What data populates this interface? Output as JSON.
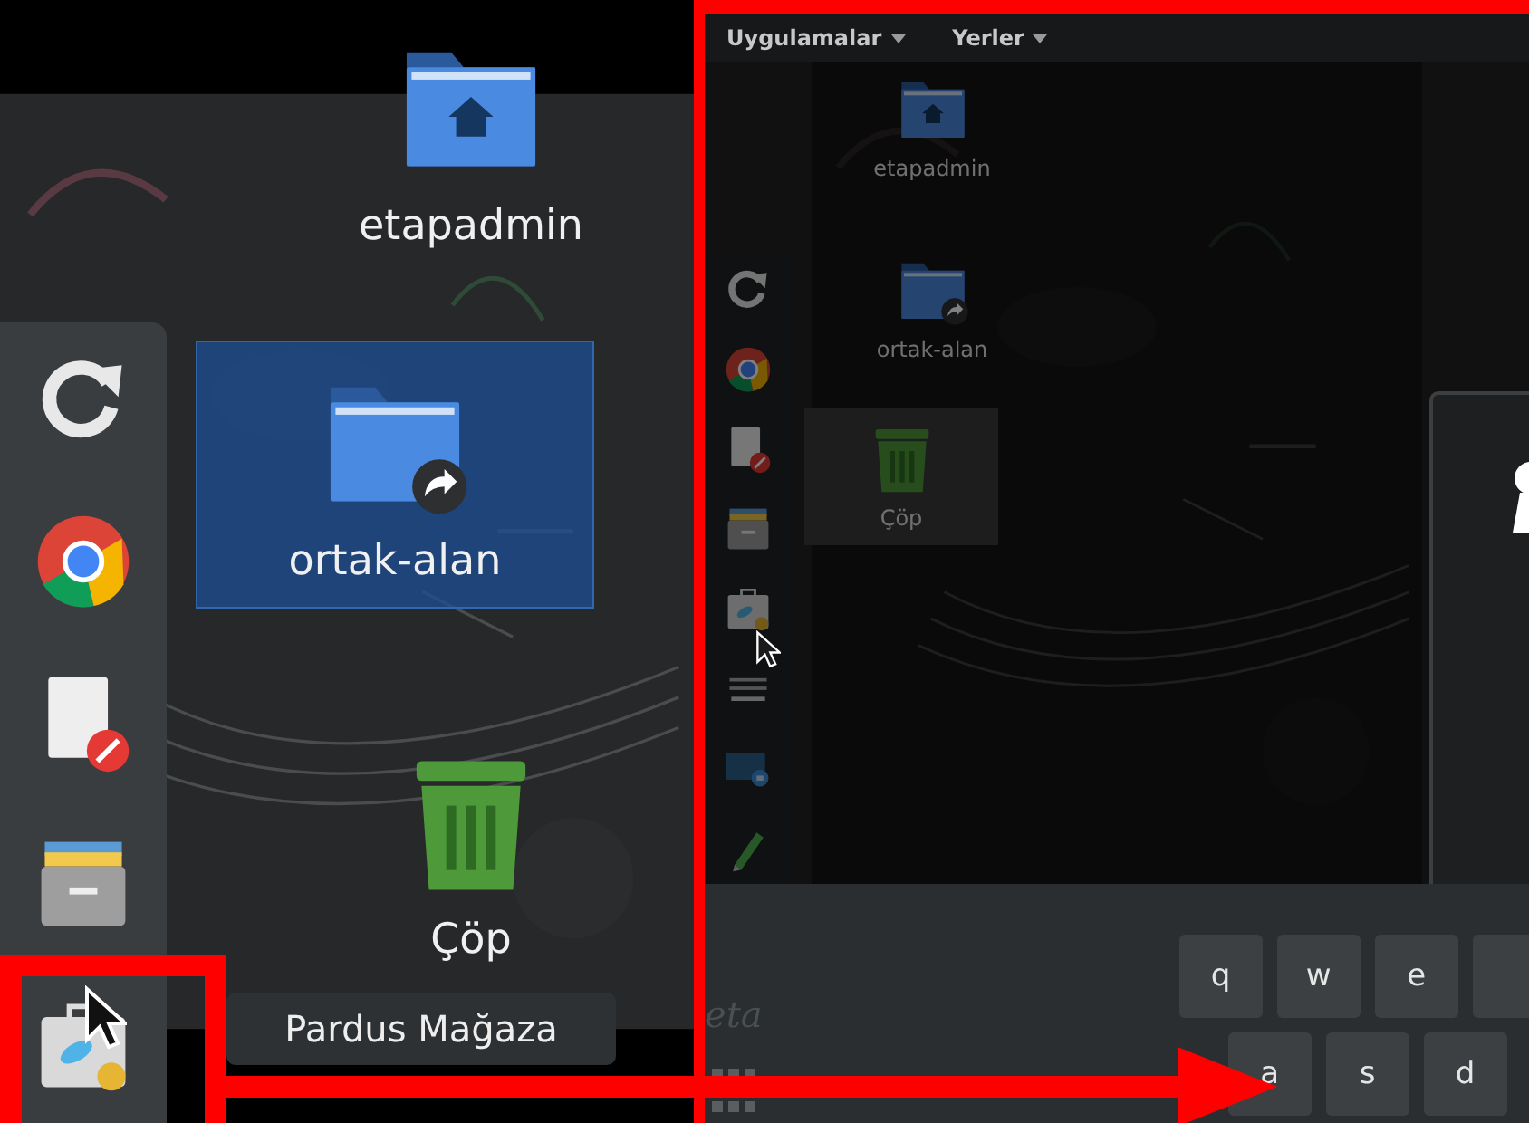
{
  "left_view": {
    "dock": [
      {
        "kind": "refresh"
      },
      {
        "kind": "browser"
      },
      {
        "kind": "editor"
      },
      {
        "kind": "archive"
      },
      {
        "kind": "store"
      }
    ],
    "desktop_icons": [
      {
        "label": "etapadmin",
        "kind": "home-folder",
        "selected": false
      },
      {
        "label": "ortak-alan",
        "kind": "shared-folder",
        "selected": true
      },
      {
        "label": "Çöp",
        "kind": "trash",
        "selected": false
      }
    ],
    "tooltip": "Pardus Mağaza"
  },
  "right_view": {
    "menus": [
      "Uygulamalar",
      "Yerler"
    ],
    "dock": [
      {
        "kind": "refresh"
      },
      {
        "kind": "browser"
      },
      {
        "kind": "editor"
      },
      {
        "kind": "archive"
      },
      {
        "kind": "store"
      },
      {
        "kind": "keyboard"
      },
      {
        "kind": "screenshot"
      },
      {
        "kind": "pencil"
      }
    ],
    "desktop_icons": [
      {
        "label": "etapadmin",
        "kind": "home-folder",
        "selected": false
      },
      {
        "label": "ortak-alan",
        "kind": "shared-folder",
        "selected": false
      },
      {
        "label": "Çöp",
        "kind": "trash",
        "selected": true
      }
    ],
    "logo": "eta",
    "keys_row_1": [
      "q",
      "w",
      "e"
    ],
    "keys_row_2": [
      "a",
      "s",
      "d"
    ]
  }
}
